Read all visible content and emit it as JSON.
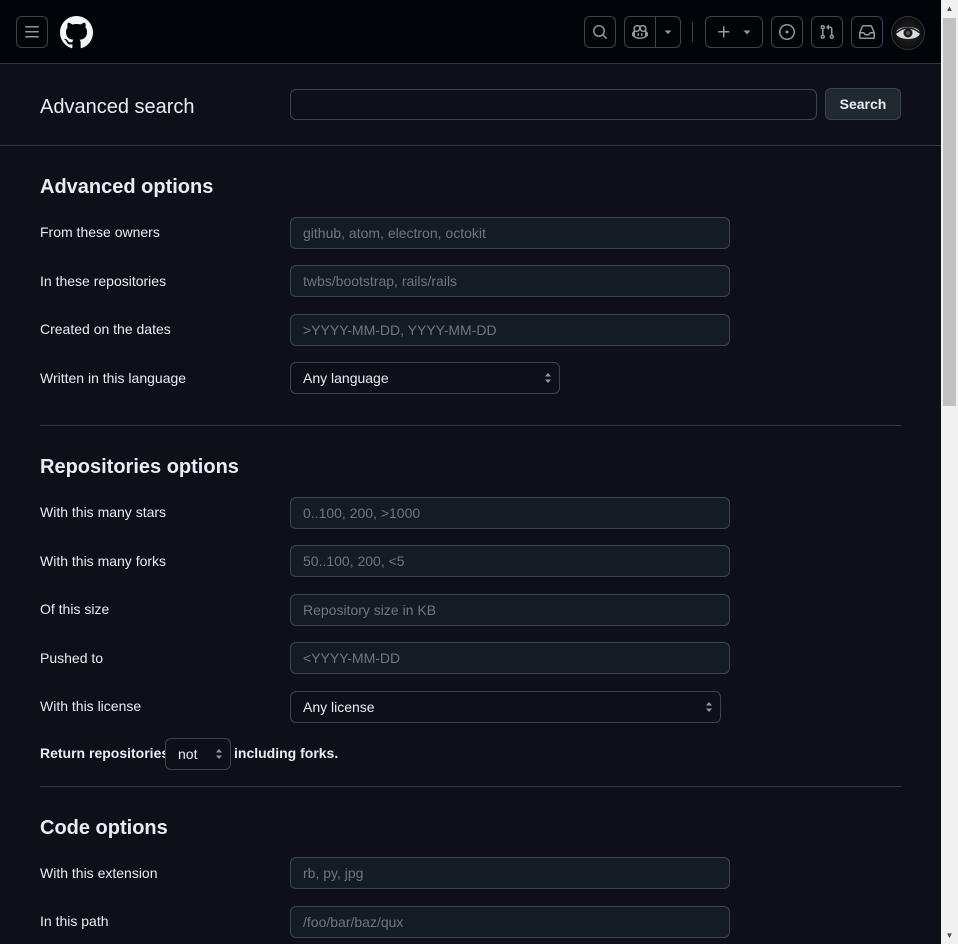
{
  "header": {
    "avatar_alt": "user avatar"
  },
  "search": {
    "title": "Advanced search",
    "input_value": "",
    "button_label": "Search"
  },
  "advanced": {
    "title": "Advanced options",
    "owners_label": "From these owners",
    "owners_placeholder": "github, atom, electron, octokit",
    "repos_label": "In these repositories",
    "repos_placeholder": "twbs/bootstrap, rails/rails",
    "dates_label": "Created on the dates",
    "dates_placeholder": ">YYYY-MM-DD, YYYY-MM-DD",
    "language_label": "Written in this language",
    "language_value": "Any language"
  },
  "repositories": {
    "title": "Repositories options",
    "stars_label": "With this many stars",
    "stars_placeholder": "0..100, 200, >1000",
    "forks_label": "With this many forks",
    "forks_placeholder": "50..100, 200, <5",
    "size_label": "Of this size",
    "size_placeholder": "Repository size in KB",
    "pushed_label": "Pushed to",
    "pushed_placeholder": "<YYYY-MM-DD",
    "license_label": "With this license",
    "license_value": "Any license",
    "return_prefix": "Return repositories",
    "return_value": "not",
    "return_suffix": "including forks."
  },
  "code": {
    "title": "Code options",
    "extension_label": "With this extension",
    "extension_placeholder": "rb, py, jpg",
    "path_label": "In this path",
    "path_placeholder": "/foo/bar/baz/qux"
  }
}
